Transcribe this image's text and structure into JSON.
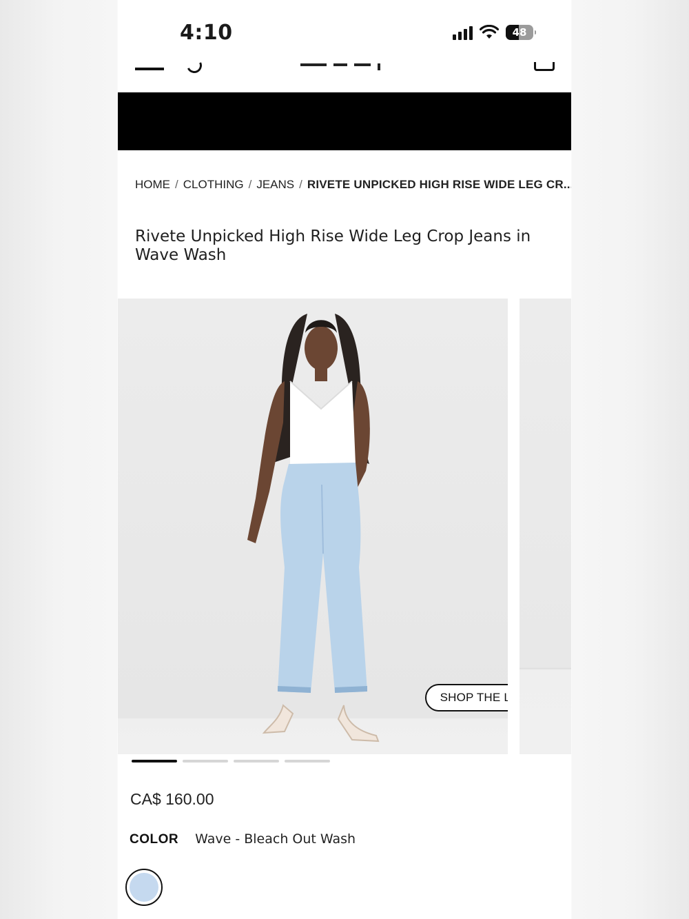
{
  "status_bar": {
    "time": "4:10",
    "battery": "48"
  },
  "breadcrumb": {
    "items": [
      "HOME",
      "CLOTHING",
      "JEANS"
    ],
    "separator": "/",
    "current": "RIVETE UNPICKED HIGH RISE WIDE LEG CR..."
  },
  "product": {
    "title": "Rivete Unpicked High Rise Wide Leg Crop Jeans in Wave Wash",
    "price": "CA$ 160.00",
    "color_label": "COLOR",
    "color_value": "Wave - Bleach Out Wash",
    "swatch_color": "#c5d9ef"
  },
  "gallery": {
    "shop_the_look": "SHOP THE LOOK",
    "slide_count": 4,
    "active_slide": 1
  },
  "icons": [
    "menu-icon",
    "search-icon",
    "bag-icon",
    "signal-icon",
    "wifi-icon",
    "battery-icon"
  ]
}
